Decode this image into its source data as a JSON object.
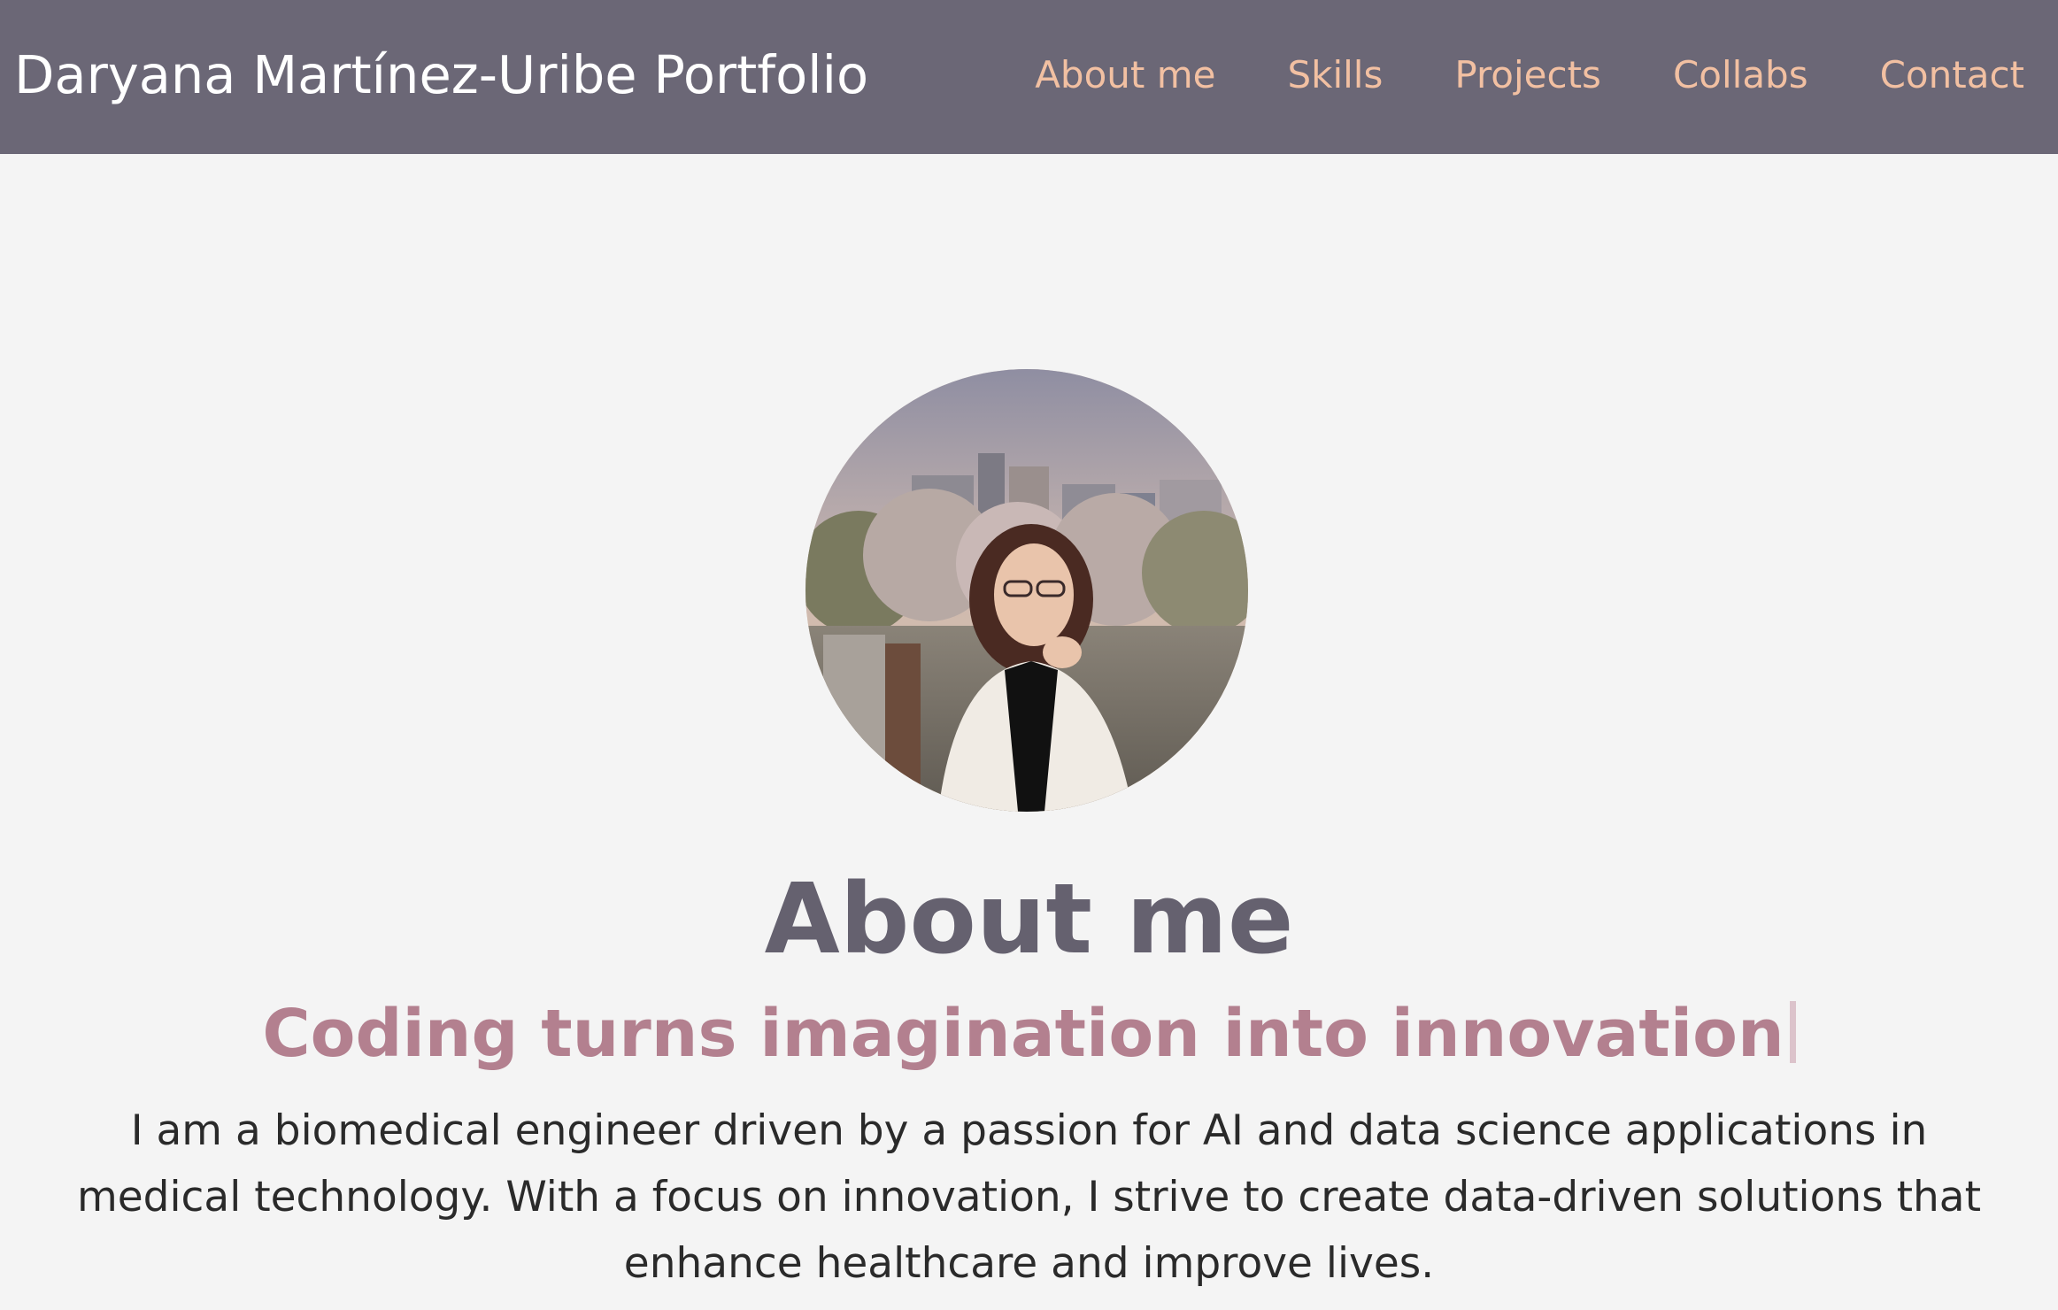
{
  "header": {
    "brand": "Daryana Martínez-Uribe Portfolio",
    "nav": [
      {
        "label": "About me"
      },
      {
        "label": "Skills"
      },
      {
        "label": "Projects"
      },
      {
        "label": "Collabs"
      },
      {
        "label": "Contact"
      }
    ]
  },
  "about": {
    "heading": "About me",
    "tagline": "Coding turns imagination into innovation",
    "bio": "I am a biomedical engineer driven by a passion for AI and data science applications in medical technology. With a focus on innovation, I strive to create data-driven solutions that enhance healthcare and improve lives."
  },
  "colors": {
    "navbar_bg": "#6b6776",
    "nav_link": "#f2c0a2",
    "page_bg": "#f4f4f4",
    "heading": "#65616f",
    "tagline": "#b3808f"
  }
}
